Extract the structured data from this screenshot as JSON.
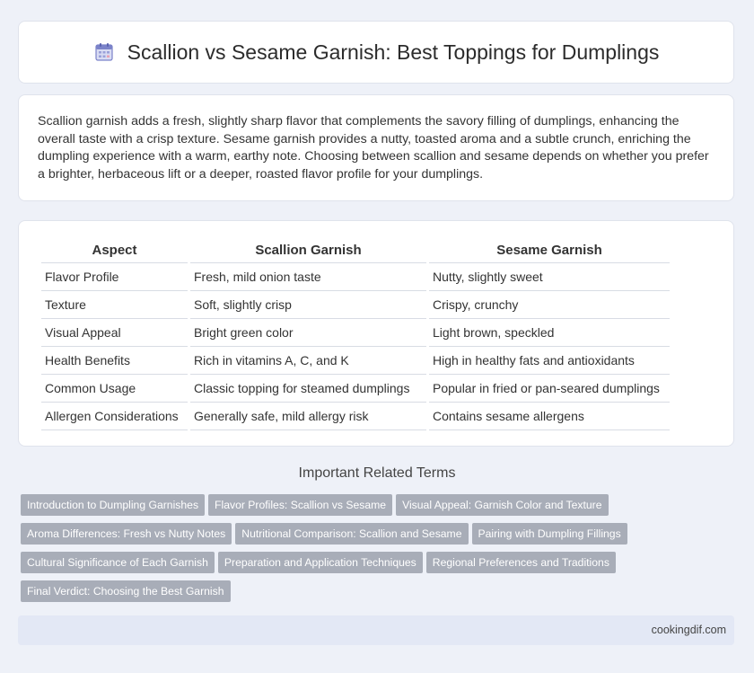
{
  "header": {
    "title": "Scallion vs Sesame Garnish: Best Toppings for Dumplings",
    "icon": "calendar-icon"
  },
  "intro": {
    "text": "Scallion garnish adds a fresh, slightly sharp flavor that complements the savory filling of dumplings, enhancing the overall taste with a crisp texture. Sesame garnish provides a nutty, toasted aroma and a subtle crunch, enriching the dumpling experience with a warm, earthy note. Choosing between scallion and sesame depends on whether you prefer a brighter, herbaceous lift or a deeper, roasted flavor profile for your dumplings."
  },
  "table": {
    "headers": [
      "Aspect",
      "Scallion Garnish",
      "Sesame Garnish"
    ],
    "rows": [
      [
        "Flavor Profile",
        "Fresh, mild onion taste",
        "Nutty, slightly sweet"
      ],
      [
        "Texture",
        "Soft, slightly crisp",
        "Crispy, crunchy"
      ],
      [
        "Visual Appeal",
        "Bright green color",
        "Light brown, speckled"
      ],
      [
        "Health Benefits",
        "Rich in vitamins A, C, and K",
        "High in healthy fats and antioxidants"
      ],
      [
        "Common Usage",
        "Classic topping for steamed dumplings",
        "Popular in fried or pan-seared dumplings"
      ],
      [
        "Allergen Considerations",
        "Generally safe, mild allergy risk",
        "Contains sesame allergens"
      ]
    ]
  },
  "related": {
    "title": "Important Related Terms",
    "tags": [
      "Introduction to Dumpling Garnishes",
      "Flavor Profiles: Scallion vs Sesame",
      "Visual Appeal: Garnish Color and Texture",
      "Aroma Differences: Fresh vs Nutty Notes",
      "Nutritional Comparison: Scallion and Sesame",
      "Pairing with Dumpling Fillings",
      "Cultural Significance of Each Garnish",
      "Preparation and Application Techniques",
      "Regional Preferences and Traditions",
      "Final Verdict: Choosing the Best Garnish"
    ]
  },
  "footer": {
    "site": "cookingdif.com"
  },
  "colors": {
    "background": "#eef1f8",
    "tag": "#a8adb8",
    "footer": "#e3e8f5",
    "icon": "#7b83c9"
  }
}
